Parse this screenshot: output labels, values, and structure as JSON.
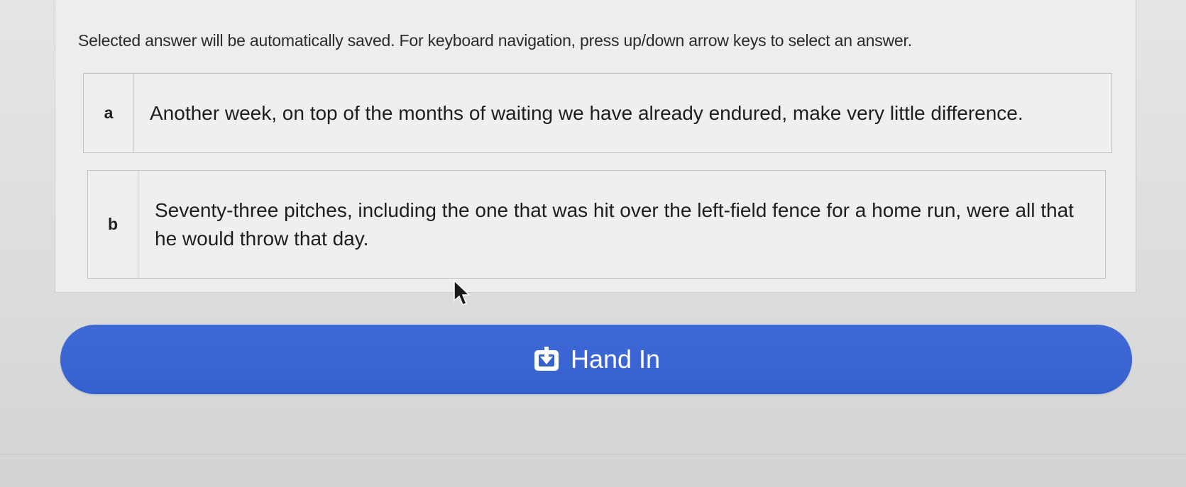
{
  "instructions": "Selected answer will be automatically saved. For keyboard navigation, press up/down arrow keys to select an answer.",
  "answers": [
    {
      "letter": "a",
      "text": "Another week, on top of the months of waiting we have already endured, make very little difference."
    },
    {
      "letter": "b",
      "text": "Seventy-three pitches, including the one that was hit over the left-field fence for a home run, were all that he would throw that day."
    }
  ],
  "submit": {
    "label": "Hand In",
    "icon": "hand-in-icon"
  },
  "colors": {
    "button_bg": "#3561cf",
    "button_text": "#ffffff",
    "panel_bg": "#ecedee"
  },
  "cursor": {
    "icon": "mouse-pointer-icon"
  }
}
